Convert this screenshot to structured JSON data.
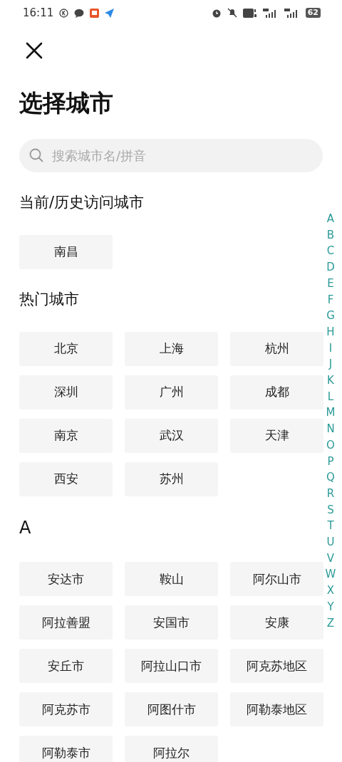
{
  "status_bar": {
    "time": "16:11",
    "battery": "62"
  },
  "title": "选择城市",
  "search": {
    "placeholder": "搜索城市名/拼音"
  },
  "sections": [
    {
      "heading": "当前/历史访问城市",
      "cities": [
        "南昌"
      ]
    },
    {
      "heading": "热门城市",
      "cities": [
        "北京",
        "上海",
        "杭州",
        "深圳",
        "广州",
        "成都",
        "南京",
        "武汉",
        "天津",
        "西安",
        "苏州"
      ]
    },
    {
      "heading": "A",
      "cities": [
        "安达市",
        "鞍山",
        "阿尔山市",
        "阿拉善盟",
        "安国市",
        "安康",
        "安丘市",
        "阿拉山口市",
        "阿克苏地区",
        "阿克苏市",
        "阿图什市",
        "阿勒泰地区",
        "阿勒泰市",
        "阿拉尔"
      ]
    }
  ],
  "index_letters": [
    "A",
    "B",
    "C",
    "D",
    "E",
    "F",
    "G",
    "H",
    "I",
    "J",
    "K",
    "L",
    "M",
    "N",
    "O",
    "P",
    "Q",
    "R",
    "S",
    "T",
    "U",
    "V",
    "W",
    "X",
    "Y",
    "Z"
  ]
}
